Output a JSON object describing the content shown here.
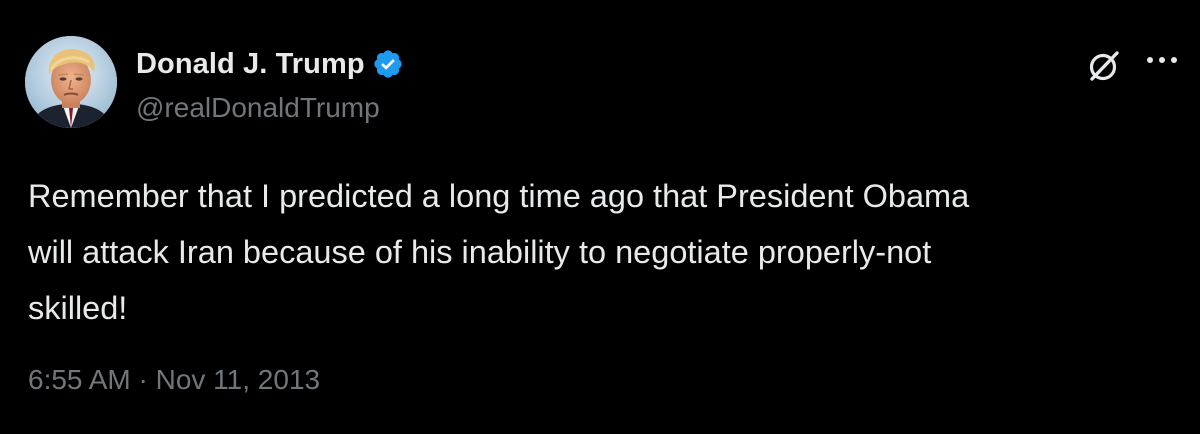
{
  "author": {
    "display_name": "Donald J. Trump",
    "handle": "@realDonaldTrump",
    "verified": true,
    "verified_color": "#1d9bf0"
  },
  "post": {
    "text": "Remember that I predicted a long time ago that President Obama\nwill attack Iran because of his inability to negotiate properly-not\nskilled!",
    "timestamp": "6:55 AM · Nov 11, 2013"
  },
  "icons": {
    "avatar": "profile-photo",
    "verified": "verified-badge-icon",
    "grok": "grok-icon",
    "more": "more-options-icon"
  },
  "colors": {
    "background": "#000000",
    "primary_text": "#e7e9ea",
    "secondary_text": "#71767b"
  }
}
